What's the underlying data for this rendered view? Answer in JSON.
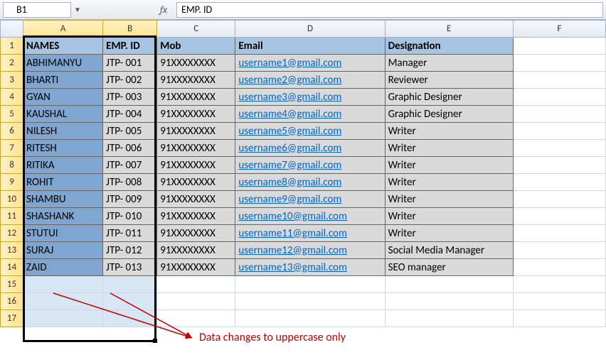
{
  "namebox": {
    "value": "B1"
  },
  "formula_bar": {
    "value": "EMP. ID"
  },
  "columns": [
    "A",
    "B",
    "C",
    "D",
    "E",
    "F"
  ],
  "selected_columns": [
    "A",
    "B"
  ],
  "row_count": 17,
  "selected_rows_all": true,
  "headers": {
    "names": "NAMES",
    "emp_id": "EMP. ID",
    "mob": "Mob",
    "email": "Email",
    "designation": "Designation"
  },
  "rows": [
    {
      "name": "ABHIMANYU",
      "emp": "JTP- 001",
      "mob": "91XXXXXXXX",
      "email": "username1@gmail.com",
      "desig": "Manager"
    },
    {
      "name": "BHARTI",
      "emp": "JTP- 002",
      "mob": "91XXXXXXXX",
      "email": "username2@gmail.com",
      "desig": "Reviewer"
    },
    {
      "name": "GYAN",
      "emp": "JTP- 003",
      "mob": "91XXXXXXXX",
      "email": "username3@gmail.com",
      "desig": "Graphic Designer"
    },
    {
      "name": "KAUSHAL",
      "emp": "JTP- 004",
      "mob": "91XXXXXXXX",
      "email": "username4@gmail.com",
      "desig": "Graphic Designer"
    },
    {
      "name": "NILESH",
      "emp": "JTP- 005",
      "mob": "91XXXXXXXX",
      "email": "username5@gmail.com",
      "desig": "Writer"
    },
    {
      "name": "RITESH",
      "emp": "JTP- 006",
      "mob": "91XXXXXXXX",
      "email": "username6@gmail.com",
      "desig": "Writer"
    },
    {
      "name": "RITIKA",
      "emp": "JTP- 007",
      "mob": "91XXXXXXXX",
      "email": "username7@gmail.com",
      "desig": "Writer"
    },
    {
      "name": "ROHIT",
      "emp": "JTP- 008",
      "mob": "91XXXXXXXX",
      "email": "username8@gmail.com",
      "desig": "Writer"
    },
    {
      "name": "SHAMBU",
      "emp": "JTP- 009",
      "mob": "91XXXXXXXX",
      "email": "username9@gmail.com",
      "desig": "Writer"
    },
    {
      "name": "SHASHANK",
      "emp": "JTP- 010",
      "mob": "91XXXXXXXX",
      "email": "username10@gmail.com",
      "desig": "Writer"
    },
    {
      "name": "STUTUI",
      "emp": "JTP- 011",
      "mob": "91XXXXXXXX",
      "email": "username11@gmail.com",
      "desig": "Writer"
    },
    {
      "name": "SURAJ",
      "emp": "JTP- 012",
      "mob": "91XXXXXXXX",
      "email": "username12@gmail.com",
      "desig": "Social Media Manager"
    },
    {
      "name": "ZAID",
      "emp": "JTP- 013",
      "mob": "91XXXXXXXX",
      "email": "username13@gmail.com",
      "desig": "SEO manager"
    }
  ],
  "annotation": {
    "text": "Data changes to uppercase only"
  }
}
